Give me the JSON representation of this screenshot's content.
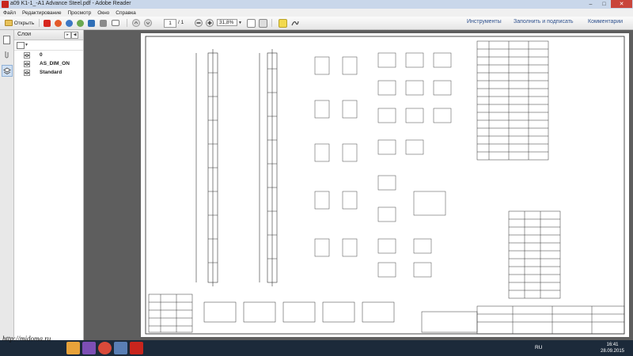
{
  "window": {
    "title": "a09 K1-1_-A1 Advance Steel.pdf - Adobe Reader"
  },
  "menu": [
    "Файл",
    "Редактирование",
    "Просмотр",
    "Окно",
    "Справка"
  ],
  "toolbar": {
    "open_label": "Открыть",
    "page_current": "1",
    "page_total": "/ 1",
    "zoom": "31,8%"
  },
  "right_tabs": [
    "Инструменты",
    "Заполнить и подписать",
    "Комментарии"
  ],
  "layers_panel": {
    "title": "Слои",
    "items": [
      "0",
      "AS_DIM_ON",
      "Standard"
    ]
  },
  "tray": {
    "lang": "RU",
    "time": "16:41",
    "date": "28.09.2015"
  },
  "watermark": "http://midoma.ru",
  "colors": {
    "titlebar": "#c9d7ea",
    "accent_link": "#2d4f8c",
    "close": "#c9453b",
    "taskbar": "#1c2a3a"
  },
  "icons": [
    "create-pdf-icon",
    "print-icon",
    "email-icon",
    "cloud-icon",
    "save-icon",
    "prev-page-icon",
    "next-page-icon",
    "zoom-out-icon",
    "zoom-in-icon",
    "fit-page-icon",
    "read-mode-icon",
    "comment-icon",
    "sign-icon"
  ]
}
